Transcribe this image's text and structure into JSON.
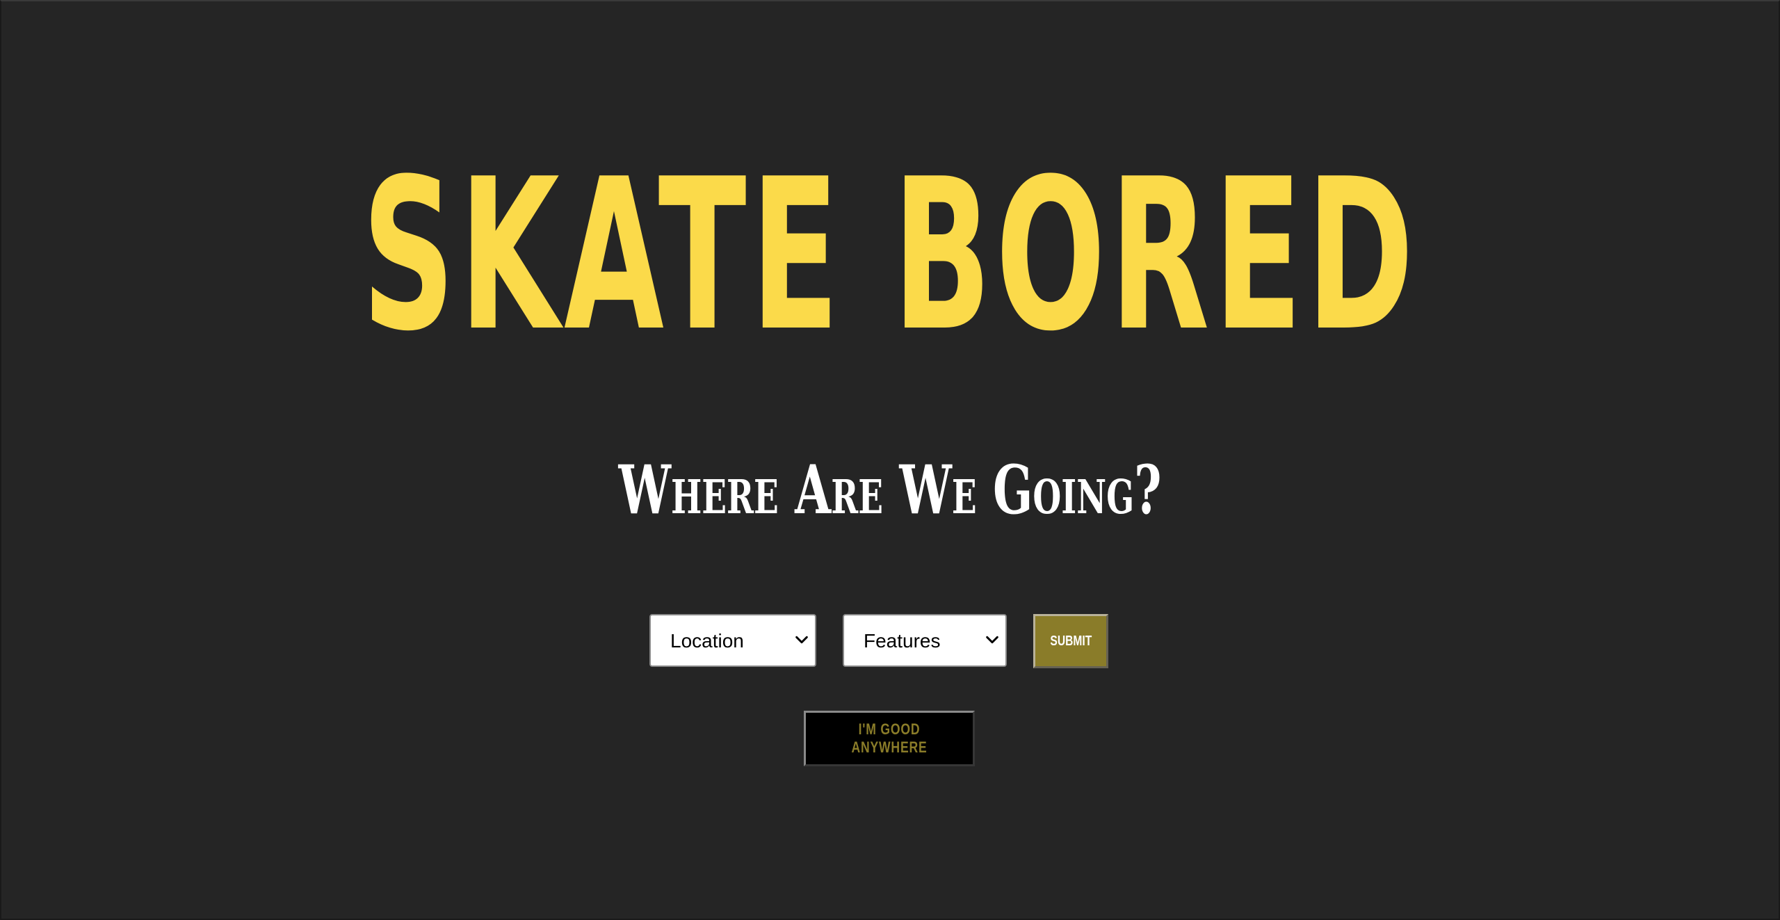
{
  "header": {
    "title": "SKATE BORED",
    "subtitle": "Where Are We Going?"
  },
  "form": {
    "location": {
      "selected": "Location",
      "options": [
        "Location"
      ]
    },
    "features": {
      "selected": "Features",
      "options": [
        "Features"
      ]
    },
    "submit_label": "SUBMIT",
    "anywhere_label": "I'M GOOD ANYWHERE"
  },
  "icons": {
    "dropdown": "chevron-down-icon"
  },
  "colors": {
    "background": "#252525",
    "title": "#fbda4a",
    "subtitle": "#ffffff",
    "submit_bg": "#8a7c29",
    "anywhere_bg": "#000000",
    "anywhere_text": "#8a7c29"
  }
}
